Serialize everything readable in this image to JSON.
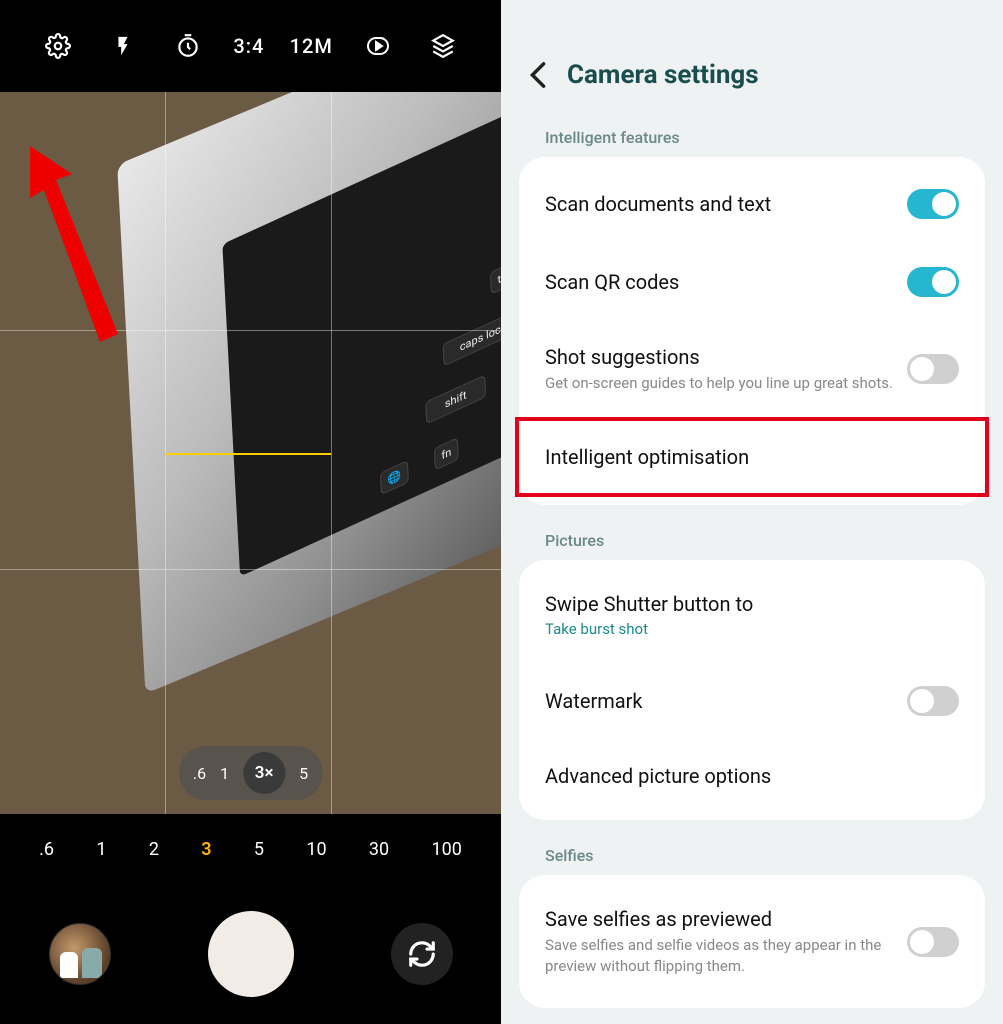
{
  "camera": {
    "topbar": {
      "ratio": "3:4",
      "resolution": "12M"
    },
    "zoom_pill": {
      "options": [
        ".6",
        "1",
        "3×",
        "5"
      ],
      "active_index": 2
    },
    "zoom_scroll": {
      "options": [
        ".6",
        "1",
        "2",
        "3",
        "5",
        "10",
        "30",
        "100"
      ],
      "active_index": 3
    }
  },
  "settings": {
    "title": "Camera settings",
    "sections": [
      {
        "label": "Intelligent features",
        "items": [
          {
            "title": "Scan documents and text",
            "toggle": true
          },
          {
            "title": "Scan QR codes",
            "toggle": true
          },
          {
            "title": "Shot suggestions",
            "subtitle": "Get on-screen guides to help you line up great shots.",
            "toggle": false
          },
          {
            "title": "Intelligent optimisation",
            "highlight": true
          }
        ]
      },
      {
        "label": "Pictures",
        "items": [
          {
            "title": "Swipe Shutter button to",
            "value": "Take burst shot"
          },
          {
            "title": "Watermark",
            "toggle": false
          },
          {
            "title": "Advanced picture options"
          }
        ]
      },
      {
        "label": "Selfies",
        "items": [
          {
            "title": "Save selfies as previewed",
            "subtitle": "Save selfies and selfie videos as they appear in the preview without flipping them.",
            "toggle": false
          }
        ]
      }
    ]
  }
}
